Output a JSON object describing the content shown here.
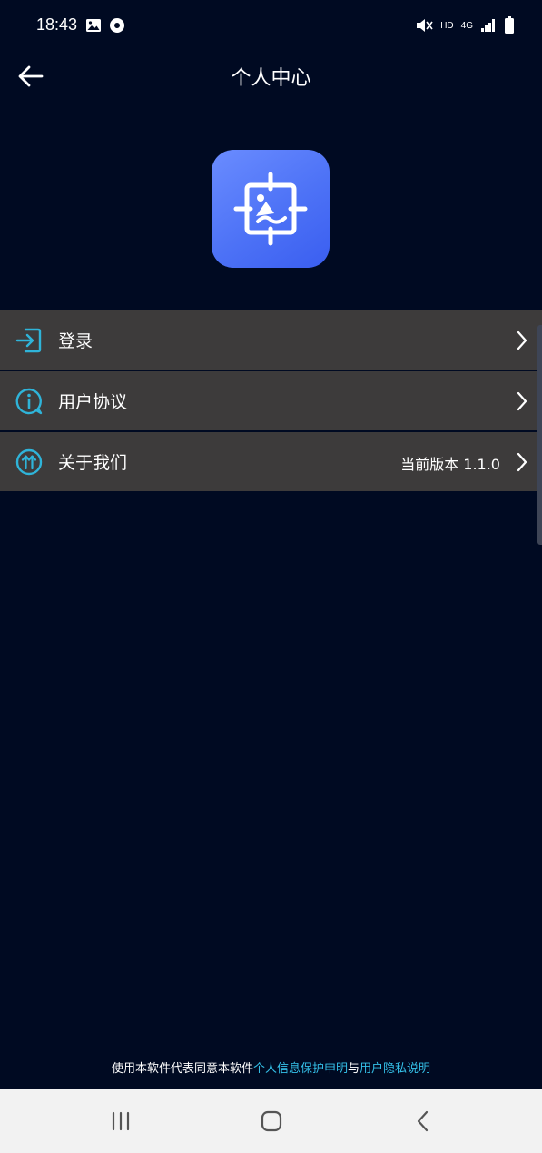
{
  "status_bar": {
    "time": "18:43",
    "hd_label": "HD",
    "network_label": "4G"
  },
  "header": {
    "title": "个人中心"
  },
  "menu": {
    "items": [
      {
        "label": "登录",
        "value": ""
      },
      {
        "label": "用户协议",
        "value": ""
      },
      {
        "label": "关于我们",
        "value": "当前版本 1.1.0"
      }
    ]
  },
  "footer": {
    "text_prefix": "使用本软件代表同意本软件",
    "link_personal": "个人信息保护申明",
    "text_and": "与",
    "link_privacy": "用户隐私说明"
  },
  "icons": {
    "back": "arrow-left-icon",
    "login": "login-icon",
    "agreement": "info-bubble-icon",
    "about": "up-arrows-icon",
    "chevron": "chevron-right-icon"
  },
  "colors": {
    "background": "#000a22",
    "menu_item": "#3d3b3b",
    "accent": "#34c0e8",
    "logo_blue": "#4d72f6"
  }
}
